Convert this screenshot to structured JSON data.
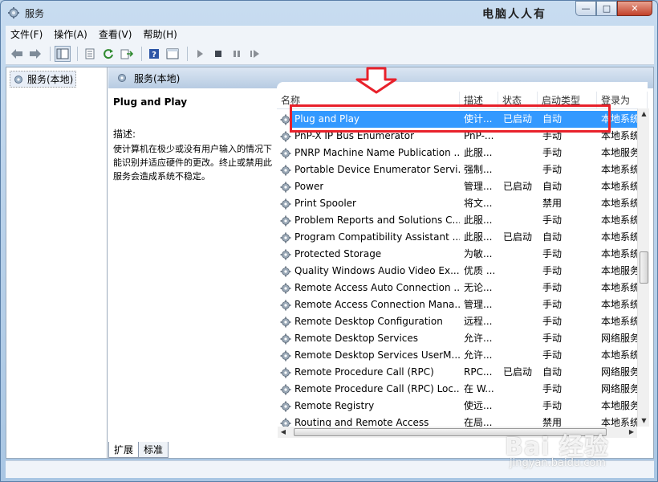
{
  "window": {
    "title": "服务",
    "watermark_top": "电脑人人有",
    "minimize_glyph": "—",
    "maximize_glyph": "□",
    "close_glyph": "✕"
  },
  "menu": {
    "items": [
      "文件(F)",
      "操作(A)",
      "查看(V)",
      "帮助(H)"
    ]
  },
  "tree": {
    "root_label": "服务(本地)"
  },
  "content": {
    "header_label": "服务(本地)",
    "selected_service_title": "Plug and Play",
    "description_label": "描述:",
    "description_text": "使计算机在极少或没有用户输入的情况下能识别并适应硬件的更改。终止或禁用此服务会造成系统不稳定。"
  },
  "columns": {
    "name": "名称",
    "desc": "描述",
    "status": "状态",
    "startup": "启动类型",
    "logon": "登录为"
  },
  "services": [
    {
      "name": "Plug and Play",
      "desc": "使计...",
      "status": "已启动",
      "startup": "自动",
      "logon": "本地系统",
      "selected": true
    },
    {
      "name": "PnP-X IP Bus Enumerator",
      "desc": "PnP-...",
      "status": "",
      "startup": "手动",
      "logon": "本地系统"
    },
    {
      "name": "PNRP Machine Name Publication ...",
      "desc": "此服...",
      "status": "",
      "startup": "手动",
      "logon": "本地服务"
    },
    {
      "name": "Portable Device Enumerator Servi...",
      "desc": "强制...",
      "status": "",
      "startup": "手动",
      "logon": "本地系统"
    },
    {
      "name": "Power",
      "desc": "管理...",
      "status": "已启动",
      "startup": "自动",
      "logon": "本地系统"
    },
    {
      "name": "Print Spooler",
      "desc": "将文...",
      "status": "",
      "startup": "禁用",
      "logon": "本地系统"
    },
    {
      "name": "Problem Reports and Solutions C...",
      "desc": "此服...",
      "status": "",
      "startup": "手动",
      "logon": "本地系统"
    },
    {
      "name": "Program Compatibility Assistant ...",
      "desc": "此服...",
      "status": "已启动",
      "startup": "自动",
      "logon": "本地系统"
    },
    {
      "name": "Protected Storage",
      "desc": "为敏...",
      "status": "",
      "startup": "手动",
      "logon": "本地系统"
    },
    {
      "name": "Quality Windows Audio Video Ex...",
      "desc": "优质 ...",
      "status": "",
      "startup": "手动",
      "logon": "本地服务"
    },
    {
      "name": "Remote Access Auto Connection ...",
      "desc": "无论...",
      "status": "",
      "startup": "手动",
      "logon": "本地系统"
    },
    {
      "name": "Remote Access Connection Mana...",
      "desc": "管理...",
      "status": "",
      "startup": "手动",
      "logon": "本地系统"
    },
    {
      "name": "Remote Desktop Configuration",
      "desc": "远程...",
      "status": "",
      "startup": "手动",
      "logon": "本地系统"
    },
    {
      "name": "Remote Desktop Services",
      "desc": "允许...",
      "status": "",
      "startup": "手动",
      "logon": "网络服务"
    },
    {
      "name": "Remote Desktop Services UserM...",
      "desc": "允许...",
      "status": "",
      "startup": "手动",
      "logon": "本地系统"
    },
    {
      "name": "Remote Procedure Call (RPC)",
      "desc": "RPC...",
      "status": "已启动",
      "startup": "自动",
      "logon": "网络服务"
    },
    {
      "name": "Remote Procedure Call (RPC) Loc...",
      "desc": "在 W...",
      "status": "",
      "startup": "手动",
      "logon": "网络服务"
    },
    {
      "name": "Remote Registry",
      "desc": "使远...",
      "status": "",
      "startup": "手动",
      "logon": "本地服务"
    },
    {
      "name": "Routing and Remote Access",
      "desc": "在局...",
      "status": "",
      "startup": "禁用",
      "logon": "本地系统"
    }
  ],
  "tabs": {
    "extended": "扩展",
    "standard": "标准"
  },
  "watermark": {
    "logo": "Bai 经验",
    "url": "jingyan.baidu.com"
  },
  "colors": {
    "selection": "#3399ff",
    "highlight": "#e8212b"
  }
}
